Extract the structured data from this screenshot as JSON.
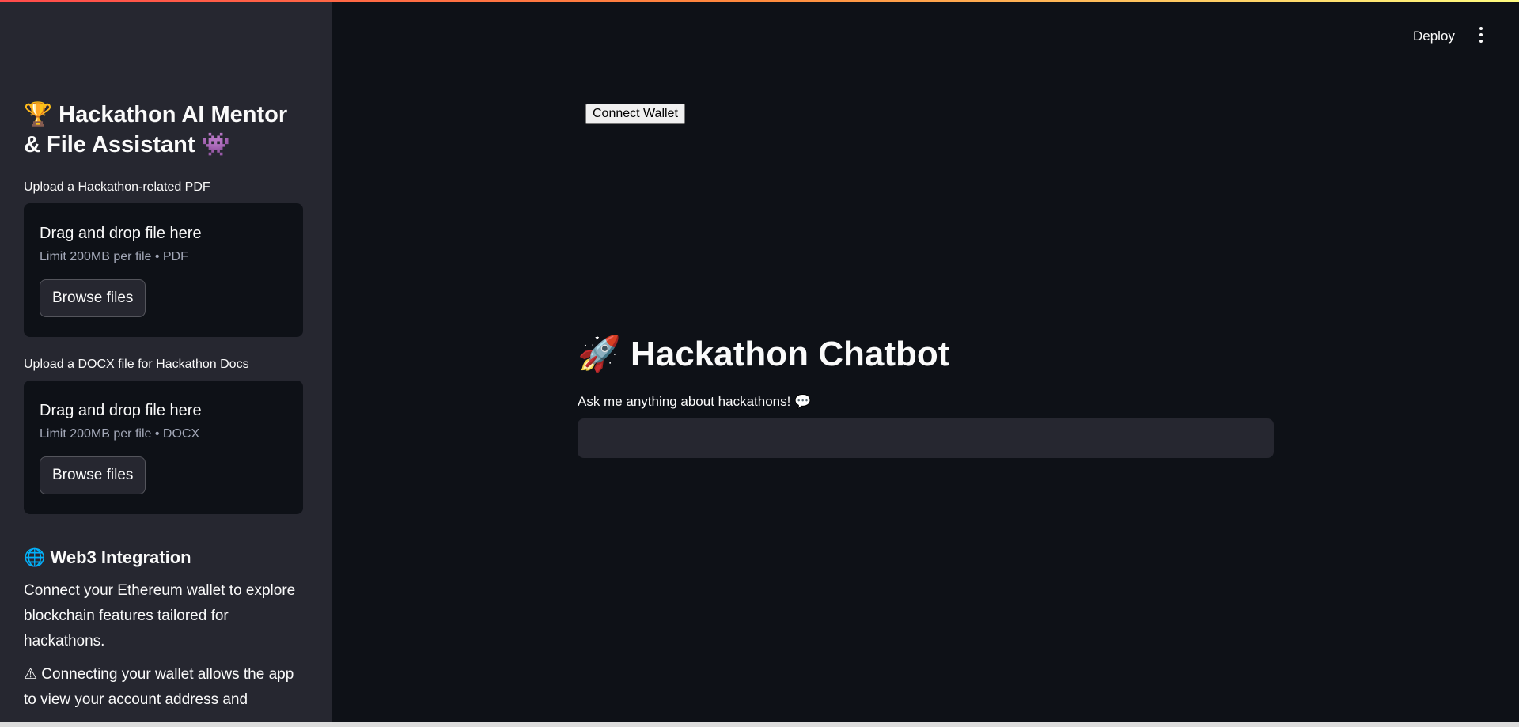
{
  "header": {
    "deploy_label": "Deploy",
    "menu_icon": "vertical-dots-icon"
  },
  "sidebar": {
    "title_icon": "🏆",
    "title_text": "Hackathon AI Mentor & File Assistant",
    "title_trailing_icon": "👾",
    "uploaders": [
      {
        "label": "Upload a Hackathon-related PDF",
        "drop_title": "Drag and drop file here",
        "limit": "Limit 200MB per file • PDF",
        "button": "Browse files"
      },
      {
        "label": "Upload a DOCX file for Hackathon Docs",
        "drop_title": "Drag and drop file here",
        "limit": "Limit 200MB per file • DOCX",
        "button": "Browse files"
      }
    ],
    "web3": {
      "icon": "🌐",
      "title": "Web3 Integration",
      "description": "Connect your Ethereum wallet to explore blockchain features tailored for hackathons.",
      "warning": "⚠ Connecting your wallet allows the app to view your account address and"
    }
  },
  "main": {
    "connect_wallet_label": "Connect Wallet",
    "title_icon": "🚀",
    "title_text": "Hackathon Chatbot",
    "ask_label": "Ask me anything about hackathons! 💬",
    "chat_input_value": ""
  },
  "colors": {
    "background": "#0e1117",
    "sidebar": "#262730",
    "accent_gradient_start": "#ff4b4b",
    "accent_gradient_end": "#fffd80"
  }
}
